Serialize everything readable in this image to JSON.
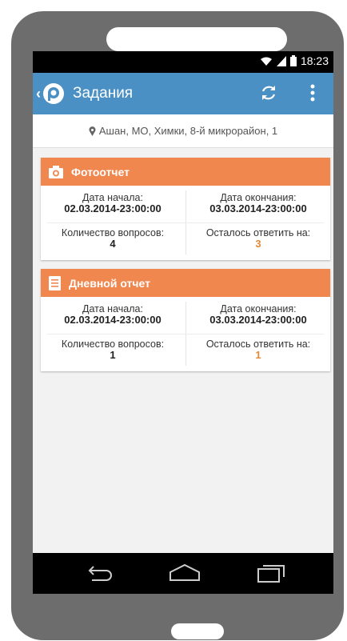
{
  "status": {
    "time": "18:23"
  },
  "appbar": {
    "title": "Задания"
  },
  "location": {
    "text": "Ашан, МО, Химки, 8-й микрорайон, 1"
  },
  "cards": [
    {
      "title": "Фотоотчет",
      "start_label": "Дата начала:",
      "start_value": "02.03.2014-23:00:00",
      "end_label": "Дата окончания:",
      "end_value": "03.03.2014-23:00:00",
      "questions_label": "Количество вопросов:",
      "questions_value": "4",
      "remaining_label": "Осталось ответить на:",
      "remaining_value": "3"
    },
    {
      "title": "Дневной отчет",
      "start_label": "Дата начала:",
      "start_value": "02.03.2014-23:00:00",
      "end_label": "Дата окончания:",
      "end_value": "03.03.2014-23:00:00",
      "questions_label": "Количество вопросов:",
      "questions_value": "1",
      "remaining_label": "Осталось ответить на:",
      "remaining_value": "1"
    }
  ],
  "colors": {
    "appbar": "#4a90c4",
    "card_header": "#f0874f",
    "accent_value": "#e08a3a",
    "phone_body": "#6d6d6d"
  },
  "icons": {
    "wifi": "wifi-icon",
    "signal": "signal-icon",
    "battery": "battery-icon",
    "back": "chevron-left-icon",
    "logo": "app-logo-icon",
    "refresh": "refresh-icon",
    "overflow": "overflow-menu-icon",
    "location": "location-pin-icon",
    "camera": "camera-icon",
    "document": "document-icon",
    "nav_back": "nav-back-icon",
    "nav_home": "nav-home-icon",
    "nav_recents": "nav-recents-icon"
  }
}
